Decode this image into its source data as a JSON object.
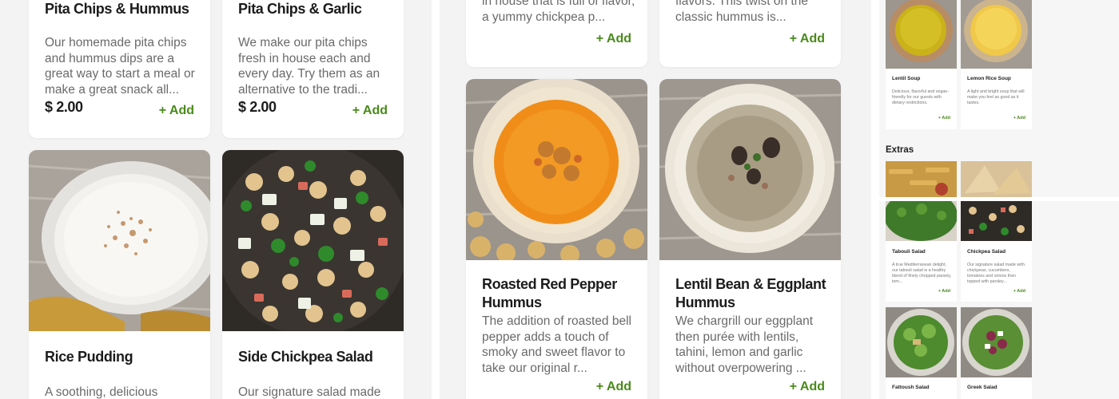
{
  "left_panel": {
    "cards": [
      {
        "title": "Pita Chips & Hummus",
        "desc": "Our homemade pita chips and hummus dips are a great way to start a meal or make a great snack all...",
        "price": "$ 2.00",
        "add": "+ Add"
      },
      {
        "title": "Pita Chips & Garlic",
        "desc": "We make our pita chips fresh in house each and every day. Try them as an alternative to the tradi...",
        "price": "$ 2.00",
        "add": "+ Add"
      },
      {
        "title": "Rice Pudding",
        "desc": "A soothing, delicious"
      },
      {
        "title": "Side Chickpea Salad",
        "desc": "Our signature salad made"
      }
    ]
  },
  "middle_panel": {
    "cards": [
      {
        "desc": "in house that is full of flavor, a yummy chickpea p...",
        "add": "+ Add"
      },
      {
        "desc": "flavors. This twist on the classic hummus is...",
        "add": "+ Add"
      },
      {
        "title": "Roasted Red Pepper Hummus",
        "desc": "The addition of roasted bell pepper adds a touch of smoky and sweet flavor to take our original r...",
        "add": "+ Add"
      },
      {
        "title": "Lentil Bean & Eggplant Hummus",
        "desc": "We chargrill our eggplant then purée with lentils, tahini, lemon and garlic without overpowering ...",
        "add": "+ Add"
      }
    ]
  },
  "right_panel": {
    "section_label": "Extras",
    "cards": [
      {
        "title": "Lentil Soup",
        "desc": "Delicious, flavorful and vegan-friendly for our guests with dietary restrictions.",
        "add": "+ Add"
      },
      {
        "title": "Lemon Rice Soup",
        "desc": "A light and bright soup that will make you feel as good as it tastes.",
        "add": "+ Add"
      },
      {
        "title": "Tabouli Salad",
        "desc": "A true Mediterranean delight, our tabouli salad is a healthy blend of finely chopped parsely, tom...",
        "add": "+ Add"
      },
      {
        "title": "Chickpea Salad",
        "desc": "Our signature salad made with chickpeas, cucumbers, tomatoes and onions then topped with parsley...",
        "add": "+ Add"
      },
      {
        "title": "Fattoush Salad"
      },
      {
        "title": "Greek Salad"
      }
    ]
  },
  "colors": {
    "add_green": "#4a8a1c",
    "background": "#f3f3f3"
  }
}
